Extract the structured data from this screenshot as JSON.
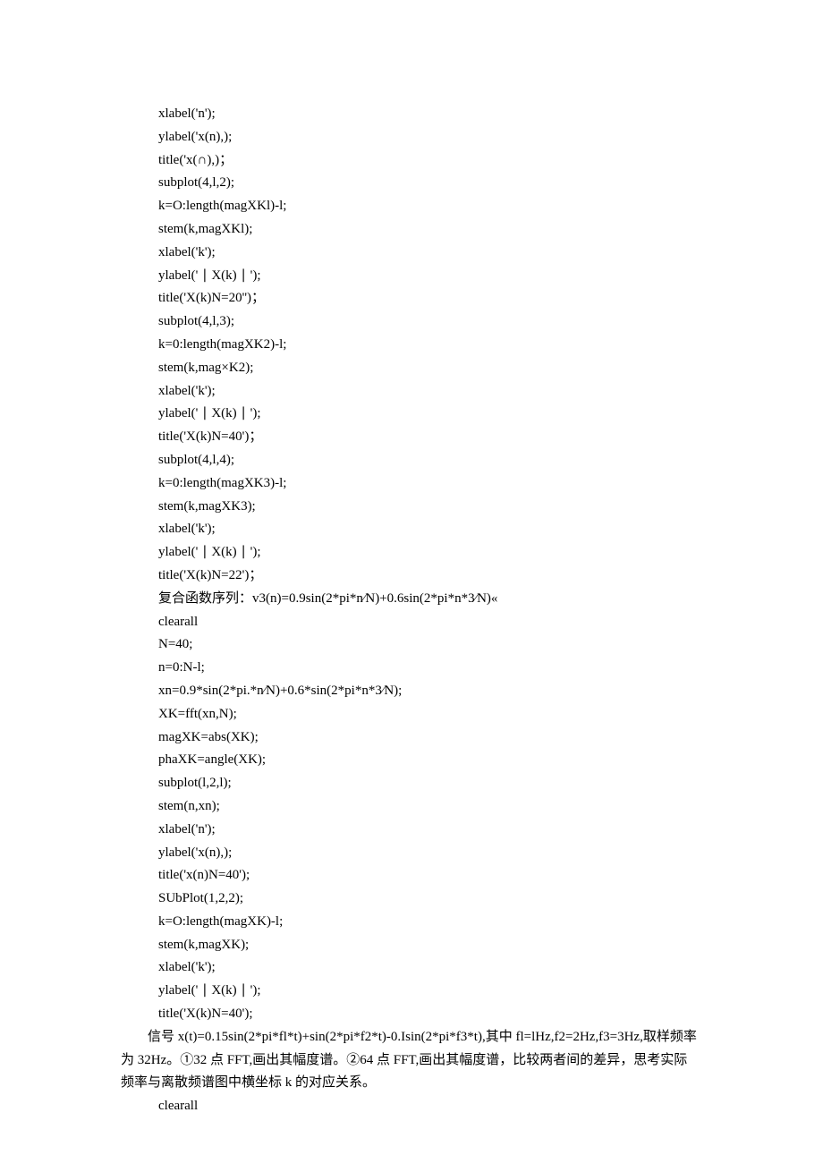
{
  "code1": [
    "xlabel('n');",
    "ylabel('x(n),);",
    "title('x(∩),)；",
    "subplot(4,l,2);",
    "k=O:length(magXKl)-l;",
    "stem(k,magXKl);",
    "xlabel('k');",
    "ylabel(' ∣ X(k) ∣ ');",
    "title('X(k)N=20'')；",
    "subplot(4,l,3);",
    "k=0:length(magXK2)-l;",
    "stem(k,mag×K2);",
    "xlabel('k');",
    "ylabel(' ∣ X(k) ∣ ');",
    "title('X(k)N=40')；",
    "subplot(4,l,4);",
    "k=0:length(magXK3)-l;",
    "stem(k,magXK3);",
    "xlabel('k');",
    "ylabel(' ∣ X(k) ∣ ');",
    "title('X(k)N=22')；",
    "复合函数序列：v3(n)=0.9sin(2*pi*n∕N)+0.6sin(2*pi*n*3∕N)«",
    "clearall",
    "N=40;",
    "n=0:N-l;",
    "xn=0.9*sin(2*pi.*n∕N)+0.6*sin(2*pi*n*3∕N);",
    "XK=fft(xn,N);",
    "magXK=abs(XK);",
    "phaXK=angle(XK);",
    "subplot(l,2,l);",
    "stem(n,xn);",
    "xlabel('n');",
    "ylabel('x(n),);",
    "title('x(n)N=40');",
    "SUbPlot(1,2,2);",
    "k=O:length(magXK)-l;",
    "stem(k,magXK);",
    "xlabel('k');",
    "ylabel(' ∣ X(k) ∣ ');",
    "title('X(k)N=40');"
  ],
  "para1": "信号 x(t)=0.15sin(2*pi*fl*t)+sin(2*pi*f2*t)-0.Isin(2*pi*f3*t),其中 fl=lHz,f2=2Hz,f3=3Hz,取样频率",
  "para2": "为 32Hz。①32 点 FFT,画出其幅度谱。②64 点 FFT,画出其幅度谱，比较两者间的差异，思考实际",
  "para3": "频率与离散频谱图中横坐标 k 的对应关系。",
  "code2": [
    "clearall"
  ]
}
